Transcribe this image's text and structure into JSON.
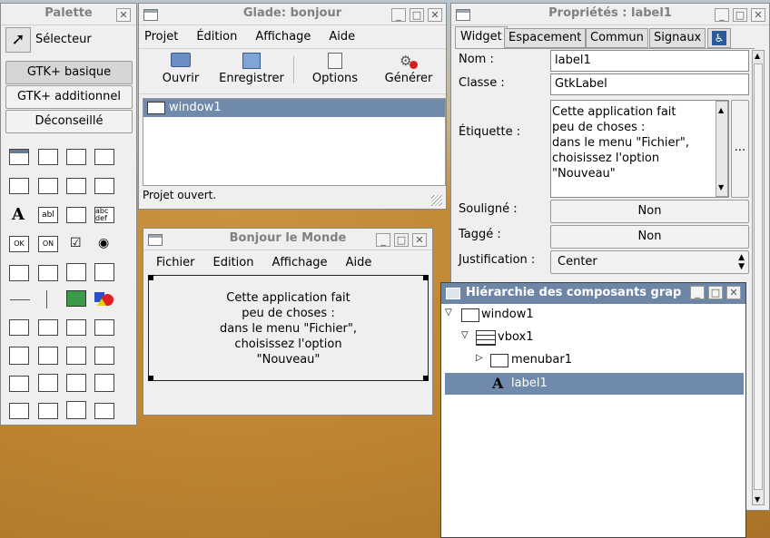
{
  "palette": {
    "title": "Palette",
    "selector_label": "Sélecteur",
    "groups": [
      "GTK+ basique",
      "GTK+ additionnel",
      "Déconseillé"
    ]
  },
  "glade": {
    "title": "Glade: bonjour",
    "menu": [
      "Projet",
      "Édition",
      "Affichage",
      "Aide"
    ],
    "toolbar": [
      "Ouvrir",
      "Enregistrer",
      "Options",
      "Générer"
    ],
    "tree_item": "window1",
    "status": "Projet ouvert."
  },
  "preview": {
    "title": "Bonjour le Monde",
    "menu": [
      "Fichier",
      "Edition",
      "Affichage",
      "Aide"
    ],
    "lines": [
      "Cette application fait",
      "peu de choses :",
      "dans le menu \"Fichier\",",
      "choisissez l'option",
      "\"Nouveau\""
    ]
  },
  "props": {
    "title": "Propriétés : label1",
    "tabs": [
      "Widget",
      "Espacement",
      "Commun",
      "Signaux"
    ],
    "nom_label": "Nom :",
    "nom_value": "label1",
    "classe_label": "Classe :",
    "classe_value": "GtkLabel",
    "etiquette_label": "Étiquette :",
    "etiquette_lines": [
      "Cette application fait",
      "peu de choses :",
      "dans le menu \"Fichier\",",
      "choisissez l'option",
      "\"Nouveau\""
    ],
    "ellipsis": "...",
    "souligne_label": "Souligné :",
    "souligne_value": "Non",
    "tagge_label": "Taggé :",
    "tagge_value": "Non",
    "justif_label": "Justification :",
    "justif_value": "Center"
  },
  "hierarchy": {
    "title": "Hiérarchie des composants grap",
    "items": [
      "window1",
      "vbox1",
      "menubar1",
      "label1"
    ]
  }
}
